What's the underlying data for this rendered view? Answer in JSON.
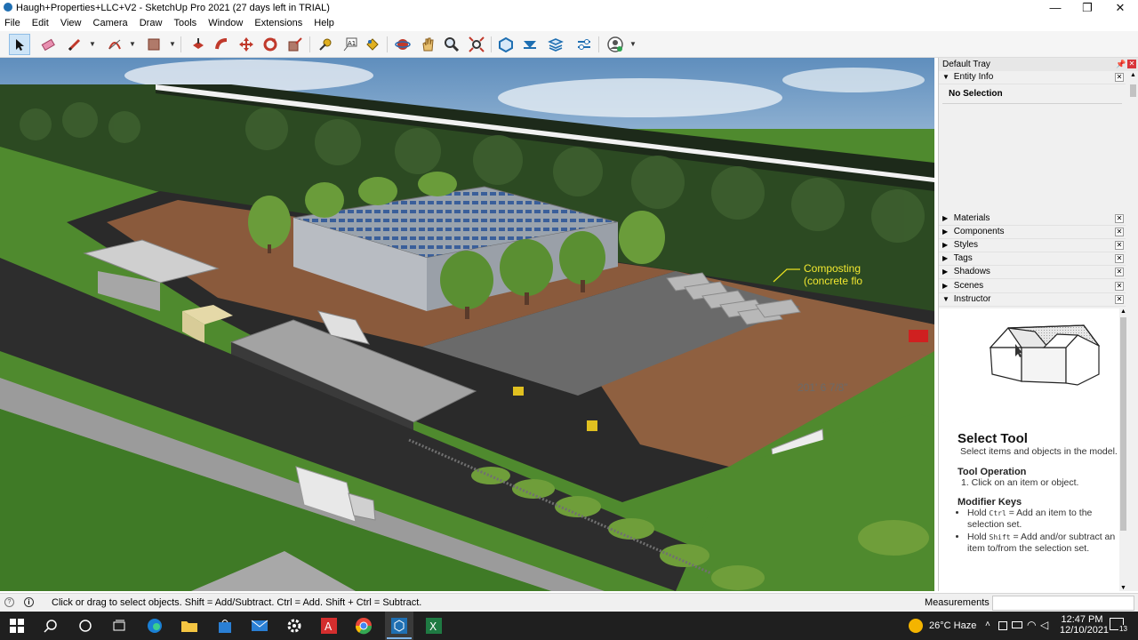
{
  "window": {
    "title": "Haugh+Properties+LLC+V2 - SketchUp Pro 2021 (27 days left in TRIAL)",
    "minimize": "—",
    "restore": "❐",
    "close": "✕"
  },
  "menu": [
    "File",
    "Edit",
    "View",
    "Camera",
    "Draw",
    "Tools",
    "Window",
    "Extensions",
    "Help"
  ],
  "scene": {
    "label_composting_line1": "Composting",
    "label_composting_line2": "(concrete flo",
    "dimension": "201' 6 7/8\""
  },
  "tray": {
    "title": "Default Tray",
    "entity_info": {
      "label": "Entity Info",
      "status": "No Selection"
    },
    "panels": [
      "Materials",
      "Components",
      "Styles",
      "Tags",
      "Shadows",
      "Scenes"
    ],
    "instructor": {
      "label": "Instructor",
      "tool_name": "Select Tool",
      "description": "Select items and objects in the model.",
      "op_heading": "Tool Operation",
      "op_step": "1. Click on an item or object.",
      "mod_heading": "Modifier Keys",
      "mod1_prefix": "Hold ",
      "mod1_key": "Ctrl",
      "mod1_rest": " = Add an item to the selection set.",
      "mod2_prefix": "Hold ",
      "mod2_key": "Shift",
      "mod2_rest": " = Add and/or subtract an item to/from the selection set."
    }
  },
  "status": {
    "hint": "Click or drag to select objects. Shift = Add/Subtract. Ctrl = Add. Shift + Ctrl = Subtract.",
    "measurements_label": "Measurements",
    "measurements_value": ""
  },
  "taskbar": {
    "weather": "26°C  Haze",
    "time": "12:47 PM",
    "date": "12/10/2021",
    "notification_count": "13"
  },
  "colors": {
    "grass": "#4f8a2e",
    "soil": "#8a5a3c",
    "asphalt": "#2a2a2a",
    "sky": "#7ea7cf",
    "accent": "#1f6fb2"
  }
}
